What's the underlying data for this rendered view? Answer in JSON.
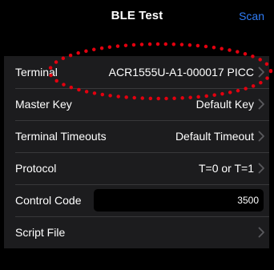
{
  "navbar": {
    "title": "BLE Test",
    "action_label": "Scan",
    "action_color": "#2f7cf6"
  },
  "settings": {
    "rows": [
      {
        "label": "Terminal",
        "value": "ACR1555U-A1-000017 PICC",
        "icon": "chevron-right-icon"
      },
      {
        "label": "Master Key",
        "value": "Default Key",
        "icon": "chevron-right-icon"
      },
      {
        "label": "Terminal Timeouts",
        "value": "Default Timeout",
        "icon": "chevron-right-icon"
      },
      {
        "label": "Protocol",
        "value": "T=0 or T=1",
        "icon": "chevron-right-icon"
      },
      {
        "label": "Control Code",
        "input_value": "3500"
      },
      {
        "label": "Script File",
        "value": "",
        "icon": "chevron-right-icon"
      }
    ]
  },
  "annotation": {
    "shape": "dotted-ellipse",
    "color": "#e3000f"
  },
  "colors": {
    "background": "#000000",
    "row_background": "#1c1c1e",
    "separator": "#38383a",
    "chevron": "#5a5a5e"
  }
}
